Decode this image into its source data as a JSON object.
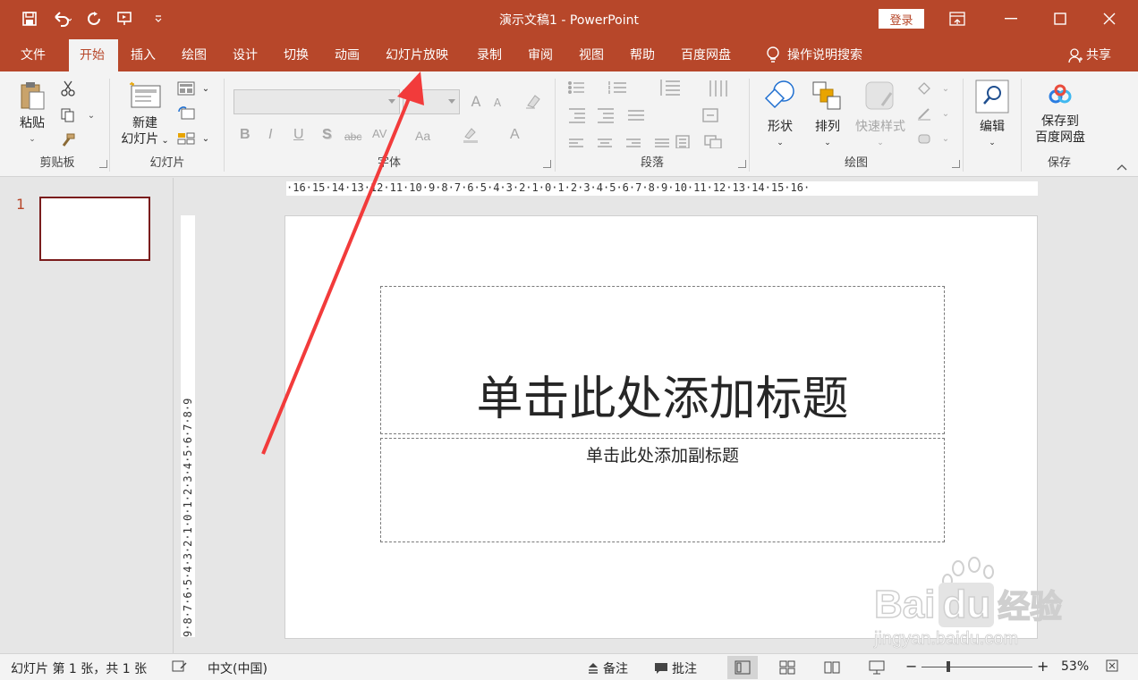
{
  "window": {
    "title": "演示文稿1  -  PowerPoint",
    "login_label": "登录"
  },
  "tabs": [
    {
      "label": "文件"
    },
    {
      "label": "开始"
    },
    {
      "label": "插入"
    },
    {
      "label": "绘图"
    },
    {
      "label": "设计"
    },
    {
      "label": "切换"
    },
    {
      "label": "动画"
    },
    {
      "label": "幻灯片放映"
    },
    {
      "label": "录制"
    },
    {
      "label": "审阅"
    },
    {
      "label": "视图"
    },
    {
      "label": "帮助"
    },
    {
      "label": "百度网盘"
    }
  ],
  "tell_me": "操作说明搜索",
  "share_label": "共享",
  "ribbon": {
    "clipboard": {
      "group_label": "剪贴板",
      "paste_label": "粘贴"
    },
    "slides": {
      "group_label": "幻灯片",
      "new_slide_label_1": "新建",
      "new_slide_label_2": "幻灯片"
    },
    "font": {
      "group_label": "字体",
      "bold": "B",
      "italic": "I",
      "underline": "U",
      "shadow": "S",
      "strike": "abc",
      "spacing": "AV",
      "case": "Aa",
      "grow": "A",
      "shrink": "A",
      "color": "A"
    },
    "paragraph": {
      "group_label": "段落"
    },
    "drawing": {
      "group_label": "绘图",
      "shapes_label": "形状",
      "arrange_label": "排列",
      "quick_styles_label": "快速样式"
    },
    "editing": {
      "edit_label": "编辑"
    },
    "save": {
      "group_label": "保存",
      "label_1": "保存到",
      "label_2": "百度网盘"
    }
  },
  "slide_panel": {
    "thumb_number": "1"
  },
  "ruler": {
    "horizontal": "·16·15·14·13·12·11·10·9·8·7·6·5·4·3·2·1·0·1·2·3·4·5·6·7·8·9·10·11·12·13·14·15·16·",
    "vertical": "9·8·7·6·5·4·3·2·1·0·1·2·3·4·5·6·7·8·9"
  },
  "slide": {
    "title_placeholder": "单击此处添加标题",
    "subtitle_placeholder": "单击此处添加副标题"
  },
  "watermark": {
    "brand": "Bai",
    "brand2": "du",
    "cn": "经验",
    "url": "jingyan.baidu.com"
  },
  "status": {
    "slide_info": "幻灯片 第 1 张，共 1 张",
    "language": "中文(中国)",
    "notes_label": "备注",
    "comments_label": "批注",
    "zoom": "53%"
  },
  "colors": {
    "accent": "#b7472a",
    "arrow": "#f23b3b"
  }
}
